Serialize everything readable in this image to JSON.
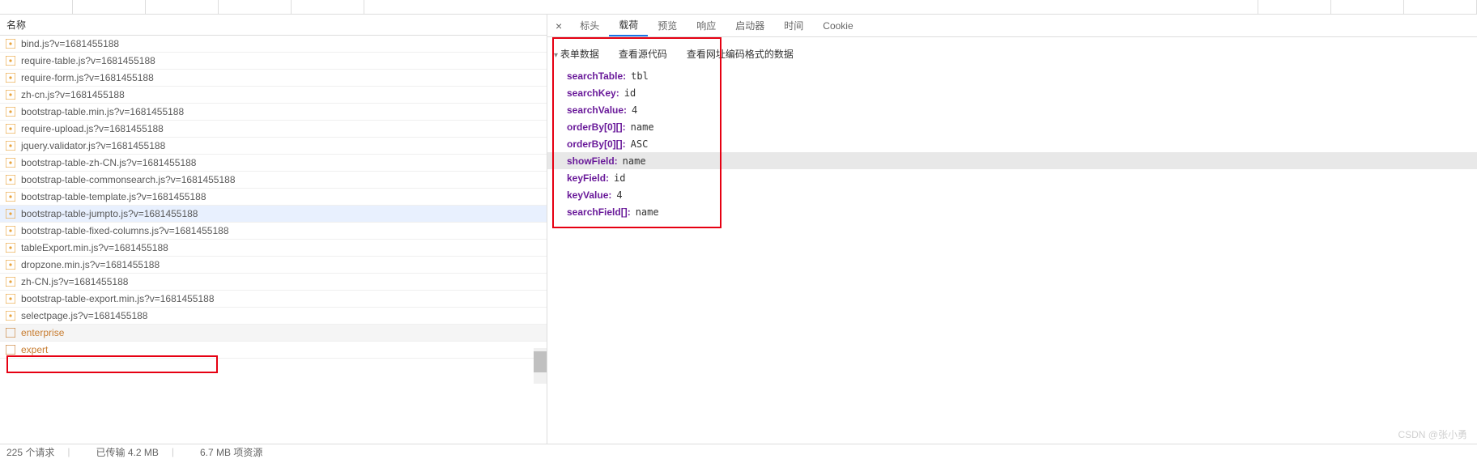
{
  "leftPanel": {
    "header": "名称",
    "files": [
      {
        "name": "bind.js?v=1681455188",
        "type": "js"
      },
      {
        "name": "require-table.js?v=1681455188",
        "type": "js"
      },
      {
        "name": "require-form.js?v=1681455188",
        "type": "js"
      },
      {
        "name": "zh-cn.js?v=1681455188",
        "type": "js"
      },
      {
        "name": "bootstrap-table.min.js?v=1681455188",
        "type": "js"
      },
      {
        "name": "require-upload.js?v=1681455188",
        "type": "js"
      },
      {
        "name": "jquery.validator.js?v=1681455188",
        "type": "js"
      },
      {
        "name": "bootstrap-table-zh-CN.js?v=1681455188",
        "type": "js"
      },
      {
        "name": "bootstrap-table-commonsearch.js?v=1681455188",
        "type": "js"
      },
      {
        "name": "bootstrap-table-template.js?v=1681455188",
        "type": "js"
      },
      {
        "name": "bootstrap-table-jumpto.js?v=1681455188",
        "type": "js",
        "selected": true
      },
      {
        "name": "bootstrap-table-fixed-columns.js?v=1681455188",
        "type": "js"
      },
      {
        "name": "tableExport.min.js?v=1681455188",
        "type": "js"
      },
      {
        "name": "dropzone.min.js?v=1681455188",
        "type": "js"
      },
      {
        "name": "zh-CN.js?v=1681455188",
        "type": "js"
      },
      {
        "name": "bootstrap-table-export.min.js?v=1681455188",
        "type": "js"
      },
      {
        "name": "selectpage.js?v=1681455188",
        "type": "js"
      },
      {
        "name": "enterprise",
        "type": "xhr",
        "highlighted": true
      },
      {
        "name": "expert",
        "type": "xhr"
      }
    ]
  },
  "footer": {
    "requests": "225 个请求",
    "transferred": "已传输 4.2 MB",
    "resources": "6.7 MB 项资源"
  },
  "rightPanel": {
    "tabs": [
      "标头",
      "载荷",
      "预览",
      "响应",
      "启动器",
      "时间",
      "Cookie"
    ],
    "activeTab": "载荷",
    "formHeader": [
      "表单数据",
      "查看源代码",
      "查看网址编码格式的数据"
    ],
    "formData": [
      {
        "key": "searchTable:",
        "val": "tbl"
      },
      {
        "key": "searchKey:",
        "val": "id"
      },
      {
        "key": "searchValue:",
        "val": "4"
      },
      {
        "key": "orderBy[0][]:",
        "val": "name"
      },
      {
        "key": "orderBy[0][]:",
        "val": "ASC"
      },
      {
        "key": "showField:",
        "val": "name",
        "sel": true
      },
      {
        "key": "keyField:",
        "val": "id"
      },
      {
        "key": "keyValue:",
        "val": "4"
      },
      {
        "key": "searchField[]:",
        "val": "name"
      }
    ]
  },
  "watermark": "CSDN @张小勇"
}
